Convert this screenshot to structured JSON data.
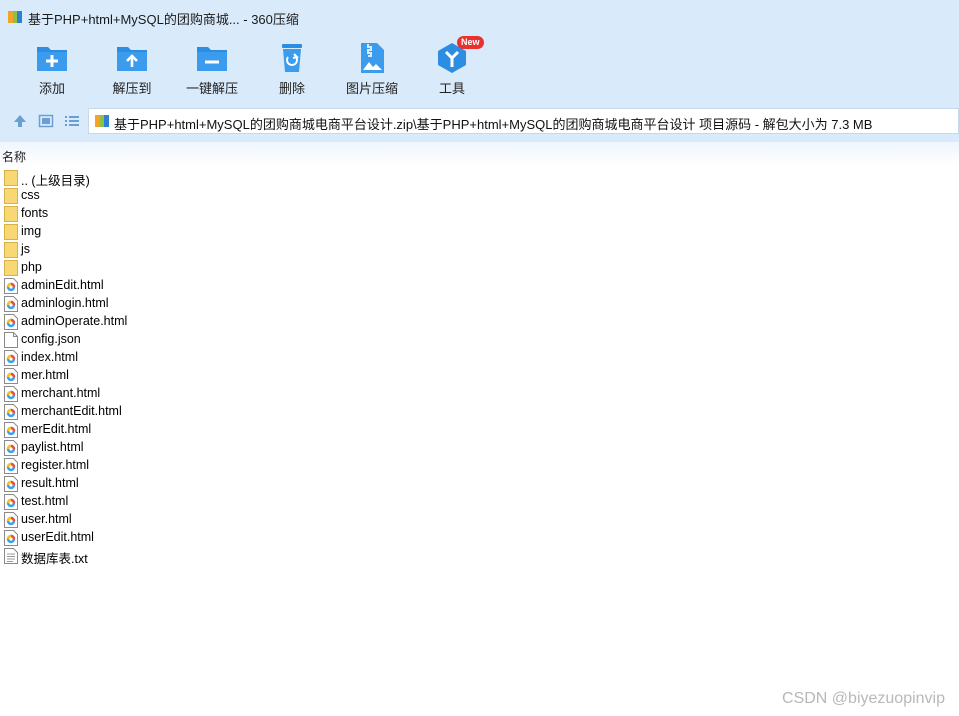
{
  "window": {
    "title": "基于PHP+html+MySQL的团购商城... - 360压缩"
  },
  "toolbar": {
    "buttons": [
      {
        "label": "添加",
        "icon": "add-folder-icon"
      },
      {
        "label": "解压到",
        "icon": "extract-to-icon"
      },
      {
        "label": "一键解压",
        "icon": "one-click-extract-icon"
      },
      {
        "label": "删除",
        "icon": "recycle-delete-icon"
      },
      {
        "label": "图片压缩",
        "icon": "image-compress-icon"
      },
      {
        "label": "工具",
        "icon": "tools-icon",
        "badge": "New"
      }
    ]
  },
  "address": {
    "path": "基于PHP+html+MySQL的团购商城电商平台设计.zip\\基于PHP+html+MySQL的团购商城电商平台设计 项目源码 - 解包大小为 7.3 MB"
  },
  "list": {
    "column_name": "名称",
    "files": [
      {
        "name": ".. (上级目录)",
        "type": "folder"
      },
      {
        "name": "css",
        "type": "folder"
      },
      {
        "name": "fonts",
        "type": "folder"
      },
      {
        "name": "img",
        "type": "folder"
      },
      {
        "name": "js",
        "type": "folder"
      },
      {
        "name": "php",
        "type": "folder"
      },
      {
        "name": "adminEdit.html",
        "type": "html"
      },
      {
        "name": "adminlogin.html",
        "type": "html"
      },
      {
        "name": "adminOperate.html",
        "type": "html"
      },
      {
        "name": "config.json",
        "type": "file"
      },
      {
        "name": "index.html",
        "type": "html"
      },
      {
        "name": "mer.html",
        "type": "html"
      },
      {
        "name": "merchant.html",
        "type": "html"
      },
      {
        "name": "merchantEdit.html",
        "type": "html"
      },
      {
        "name": "merEdit.html",
        "type": "html"
      },
      {
        "name": "paylist.html",
        "type": "html"
      },
      {
        "name": "register.html",
        "type": "html"
      },
      {
        "name": "result.html",
        "type": "html"
      },
      {
        "name": "test.html",
        "type": "html"
      },
      {
        "name": "user.html",
        "type": "html"
      },
      {
        "name": "userEdit.html",
        "type": "html"
      },
      {
        "name": "数据库表.txt",
        "type": "txt"
      }
    ]
  },
  "watermark": "CSDN @biyezuopinvip",
  "colors": {
    "chrome": "#d9eafb",
    "accent": "#2d8de0",
    "badge": "#e8322e",
    "folder": "#f8d775"
  }
}
